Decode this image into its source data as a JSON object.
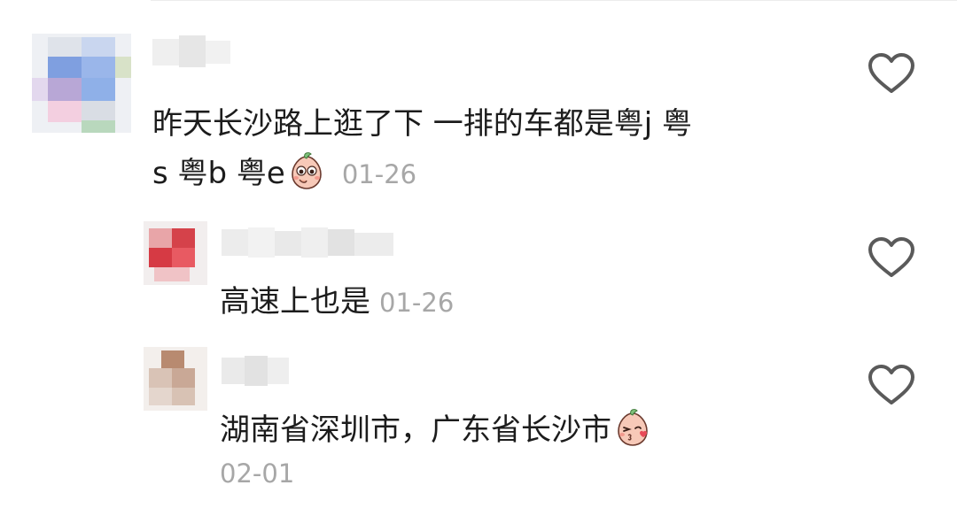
{
  "comments": [
    {
      "text_line1": "昨天长沙路上逛了下 一排的车都是粤j 粤",
      "text_line2": "s 粤b 粤e",
      "emoji": "peach-shy-emoji",
      "date": "01-26",
      "like_icon": "heart-outline-icon"
    },
    {
      "text": "高速上也是",
      "date": "01-26",
      "like_icon": "heart-outline-icon"
    },
    {
      "text": "湖南省深圳市，广东省长沙市",
      "emoji": "peach-kiss-emoji",
      "date": "02-01",
      "like_icon": "heart-outline-icon"
    }
  ],
  "colors": {
    "text": "#1c1c1c",
    "date": "#a7a7a7",
    "icon": "#5a5a5a"
  }
}
